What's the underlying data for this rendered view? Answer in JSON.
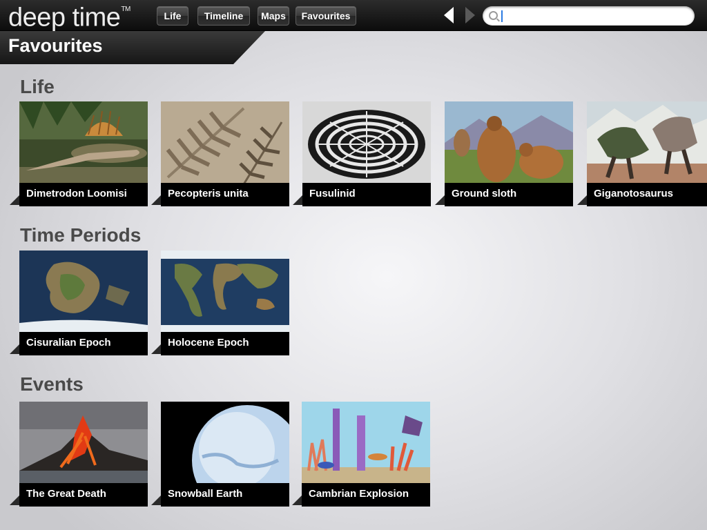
{
  "app": {
    "logo_text": "deep time",
    "logo_mark": "TM"
  },
  "nav": {
    "tabs": [
      "Life",
      "Timeline",
      "Maps",
      "Favourites"
    ],
    "back_icon": "back-arrow-icon",
    "forward_icon": "forward-arrow-icon"
  },
  "search": {
    "value": "",
    "icon": "search-icon"
  },
  "page": {
    "title": "Favourites"
  },
  "sections": {
    "life": {
      "title": "Life",
      "items": [
        "Dimetrodon Loomisi",
        "Pecopteris unita",
        "Fusulinid",
        "Ground sloth",
        "Giganotosaurus"
      ]
    },
    "periods": {
      "title": "Time Periods",
      "items": [
        "Cisuralian Epoch",
        "Holocene Epoch"
      ]
    },
    "events": {
      "title": "Events",
      "items": [
        "The Great Death",
        "Snowball Earth",
        "Cambrian Explosion"
      ]
    }
  }
}
